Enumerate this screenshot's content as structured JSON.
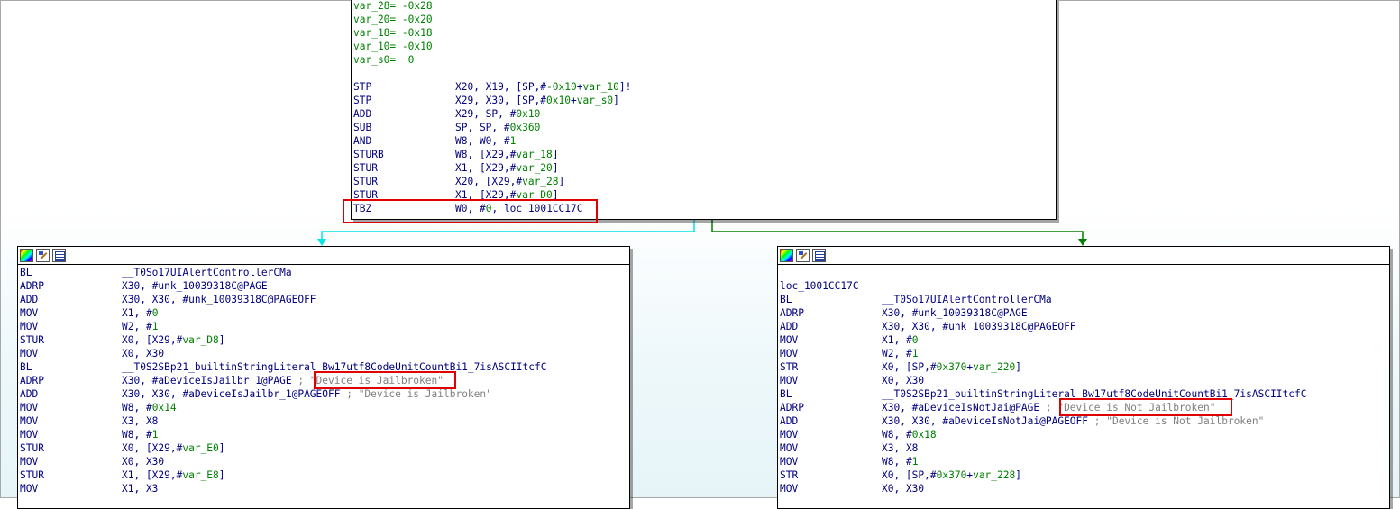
{
  "top_block": {
    "vars": [
      "var_28= -0x28",
      "var_20= -0x20",
      "var_18= -0x18",
      "var_10= -0x10",
      "var_s0=  0"
    ],
    "instrs": [
      {
        "m": "STP",
        "o": "X20, X19, [SP,#-0x10+var_10]!"
      },
      {
        "m": "STP",
        "o": "X29, X30, [SP,#0x10+var_s0]"
      },
      {
        "m": "ADD",
        "o": "X29, SP, #0x10"
      },
      {
        "m": "SUB",
        "o": "SP, SP, #0x360"
      },
      {
        "m": "AND",
        "o": "W8, W0, #1"
      },
      {
        "m": "STURB",
        "o": "W8, [X29,#var_18]"
      },
      {
        "m": "STUR",
        "o": "X1, [X29,#var_20]"
      },
      {
        "m": "STUR",
        "o": "X20, [X29,#var_28]"
      },
      {
        "m": "STUR",
        "o": "X1, [X29,#var_D0]"
      },
      {
        "m": "TBZ",
        "o": "W0, #0, loc_1001CC17C"
      }
    ]
  },
  "left_block": {
    "instrs": [
      {
        "m": "BL",
        "o": "__T0So17UIAlertControllerCMa"
      },
      {
        "m": "ADRP",
        "o": "X30, #unk_10039318C@PAGE"
      },
      {
        "m": "ADD",
        "o": "X30, X30, #unk_10039318C@PAGEOFF"
      },
      {
        "m": "MOV",
        "o": "X1, #0"
      },
      {
        "m": "MOV",
        "o": "W2, #1"
      },
      {
        "m": "STUR",
        "o": "X0, [X29,#var_D8]"
      },
      {
        "m": "MOV",
        "o": "X0, X30"
      },
      {
        "m": "BL",
        "o": "__T0S2SBp21_builtinStringLiteral_Bw17utf8CodeUnitCountBi1_7isASCIItcfC"
      },
      {
        "m": "ADRP",
        "o": "X30, #aDeviceIsJailbr_1@PAGE ; \"Device is Jailbroken\""
      },
      {
        "m": "ADD",
        "o": "X30, X30, #aDeviceIsJailbr_1@PAGEOFF ; \"Device is Jailbroken\""
      },
      {
        "m": "MOV",
        "o": "W8, #0x14"
      },
      {
        "m": "MOV",
        "o": "X3, X8"
      },
      {
        "m": "MOV",
        "o": "W8, #1"
      },
      {
        "m": "STUR",
        "o": "X0, [X29,#var_E0]"
      },
      {
        "m": "MOV",
        "o": "X0, X30"
      },
      {
        "m": "STUR",
        "o": "X1, [X29,#var_E8]"
      },
      {
        "m": "MOV",
        "o": "X1, X3"
      }
    ]
  },
  "right_block": {
    "label": "loc_1001CC17C",
    "instrs": [
      {
        "m": "BL",
        "o": "__T0So17UIAlertControllerCMa"
      },
      {
        "m": "ADRP",
        "o": "X30, #unk_10039318C@PAGE"
      },
      {
        "m": "ADD",
        "o": "X30, X30, #unk_10039318C@PAGEOFF"
      },
      {
        "m": "MOV",
        "o": "X1, #0"
      },
      {
        "m": "MOV",
        "o": "W2, #1"
      },
      {
        "m": "STR",
        "o": "X0, [SP,#0x370+var_220]"
      },
      {
        "m": "MOV",
        "o": "X0, X30"
      },
      {
        "m": "BL",
        "o": "__T0S2SBp21_builtinStringLiteral_Bw17utf8CodeUnitCountBi1_7isASCIItcfC"
      },
      {
        "m": "ADRP",
        "o": "X30, #aDeviceIsNotJai@PAGE ; \"Device is Not Jailbroken\""
      },
      {
        "m": "ADD",
        "o": "X30, X30, #aDeviceIsNotJai@PAGEOFF ; \"Device is Not Jailbroken\""
      },
      {
        "m": "MOV",
        "o": "W8, #0x18"
      },
      {
        "m": "MOV",
        "o": "X3, X8"
      },
      {
        "m": "MOV",
        "o": "W8, #1"
      },
      {
        "m": "STR",
        "o": "X0, [SP,#0x370+var_228]"
      },
      {
        "m": "MOV",
        "o": "X0, X30"
      }
    ]
  },
  "colors": {
    "mnemonic": "#000080",
    "comment": "#808080",
    "highlight": "#e00000",
    "edge_false": "#00e0e0",
    "edge_true": "#008000"
  }
}
